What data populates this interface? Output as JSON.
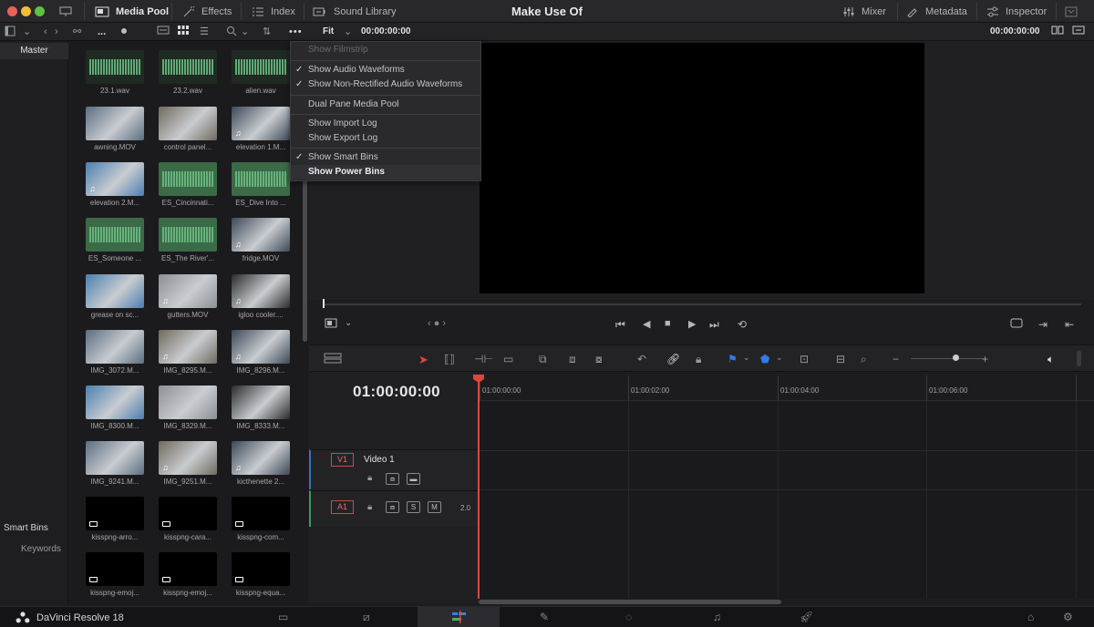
{
  "window": {
    "title": "Make Use Of"
  },
  "topbar": {
    "left": [
      {
        "label": "Media Pool",
        "active": true
      },
      {
        "label": "Effects",
        "active": false
      },
      {
        "label": "Index",
        "active": false
      },
      {
        "label": "Sound Library",
        "active": false
      }
    ],
    "right": [
      {
        "label": "Mixer"
      },
      {
        "label": "Metadata"
      },
      {
        "label": "Inspector"
      }
    ]
  },
  "toolbar2": {
    "more_label": "...",
    "zoom_value": "Fit",
    "timecode_left": "00:00:00:00",
    "timecode_right": "00:00:00:00"
  },
  "sidebar": {
    "master_label": "Master",
    "smart_bins_label": "Smart Bins",
    "keywords_label": "Keywords"
  },
  "clips": [
    {
      "name": "23.1.wav",
      "kind": "audio"
    },
    {
      "name": "23.2.wav",
      "kind": "audio"
    },
    {
      "name": "alien.wav",
      "kind": "audio"
    },
    {
      "name": "awning.MOV",
      "kind": "video"
    },
    {
      "name": "control panel...",
      "kind": "video"
    },
    {
      "name": "elevation 1.M...",
      "kind": "video-audio"
    },
    {
      "name": "elevation 2.M...",
      "kind": "video-audio"
    },
    {
      "name": "ES_Cincinnati...",
      "kind": "audio-green"
    },
    {
      "name": "ES_Dive Into ...",
      "kind": "audio-green"
    },
    {
      "name": "ES_Someone ...",
      "kind": "audio-green"
    },
    {
      "name": "ES_The River'...",
      "kind": "audio-green"
    },
    {
      "name": "fridge.MOV",
      "kind": "video-audio"
    },
    {
      "name": "grease on sc...",
      "kind": "video"
    },
    {
      "name": "gutters.MOV",
      "kind": "video-audio"
    },
    {
      "name": "igloo cooler....",
      "kind": "video-audio"
    },
    {
      "name": "IMG_3072.M...",
      "kind": "video"
    },
    {
      "name": "IMG_8295.M...",
      "kind": "video-audio"
    },
    {
      "name": "IMG_8296.M...",
      "kind": "video-audio"
    },
    {
      "name": "IMG_8300.M...",
      "kind": "video"
    },
    {
      "name": "IMG_8329.M...",
      "kind": "video"
    },
    {
      "name": "IMG_8333.M...",
      "kind": "video"
    },
    {
      "name": "IMG_9241.M...",
      "kind": "video"
    },
    {
      "name": "IMG_9251.M...",
      "kind": "video-audio"
    },
    {
      "name": "kicthenette 2...",
      "kind": "video-audio"
    },
    {
      "name": "kisspng-arro...",
      "kind": "image"
    },
    {
      "name": "kisspng-cara...",
      "kind": "image"
    },
    {
      "name": "kisspng-com...",
      "kind": "image"
    },
    {
      "name": "kisspng-emoj...",
      "kind": "image"
    },
    {
      "name": "kisspng-emoj...",
      "kind": "image"
    },
    {
      "name": "kisspng-equa...",
      "kind": "image"
    }
  ],
  "menu": {
    "items": [
      {
        "label": "Show Filmstrip",
        "checked": false,
        "disabled": true
      },
      {
        "label": "Show Audio Waveforms",
        "checked": true
      },
      {
        "label": "Show Non-Rectified Audio Waveforms",
        "checked": true
      },
      {
        "label": "Dual Pane Media Pool",
        "checked": false
      },
      {
        "label": "Show Import Log",
        "checked": false
      },
      {
        "label": "Show Export Log",
        "checked": false
      },
      {
        "label": "Show Smart Bins",
        "checked": true
      },
      {
        "label": "Show Power Bins",
        "checked": false,
        "highlighted": true
      }
    ]
  },
  "timeline": {
    "timecode": "01:00:00:00",
    "ruler": [
      "01:00:00:00",
      "01:00:02:00",
      "01:00:04:00",
      "01:00:06:00"
    ],
    "tracks": [
      {
        "tag": "V1",
        "name": "Video 1"
      },
      {
        "tag": "A1",
        "name": "",
        "level": "2.0",
        "solo": "S",
        "mute": "M"
      }
    ]
  },
  "bottombar": {
    "app_name": "DaVinci Resolve 18"
  },
  "colors": {
    "accent_red": "#e2443a",
    "viewer_bg": "#000000",
    "waveform_green": "#6dc086"
  }
}
